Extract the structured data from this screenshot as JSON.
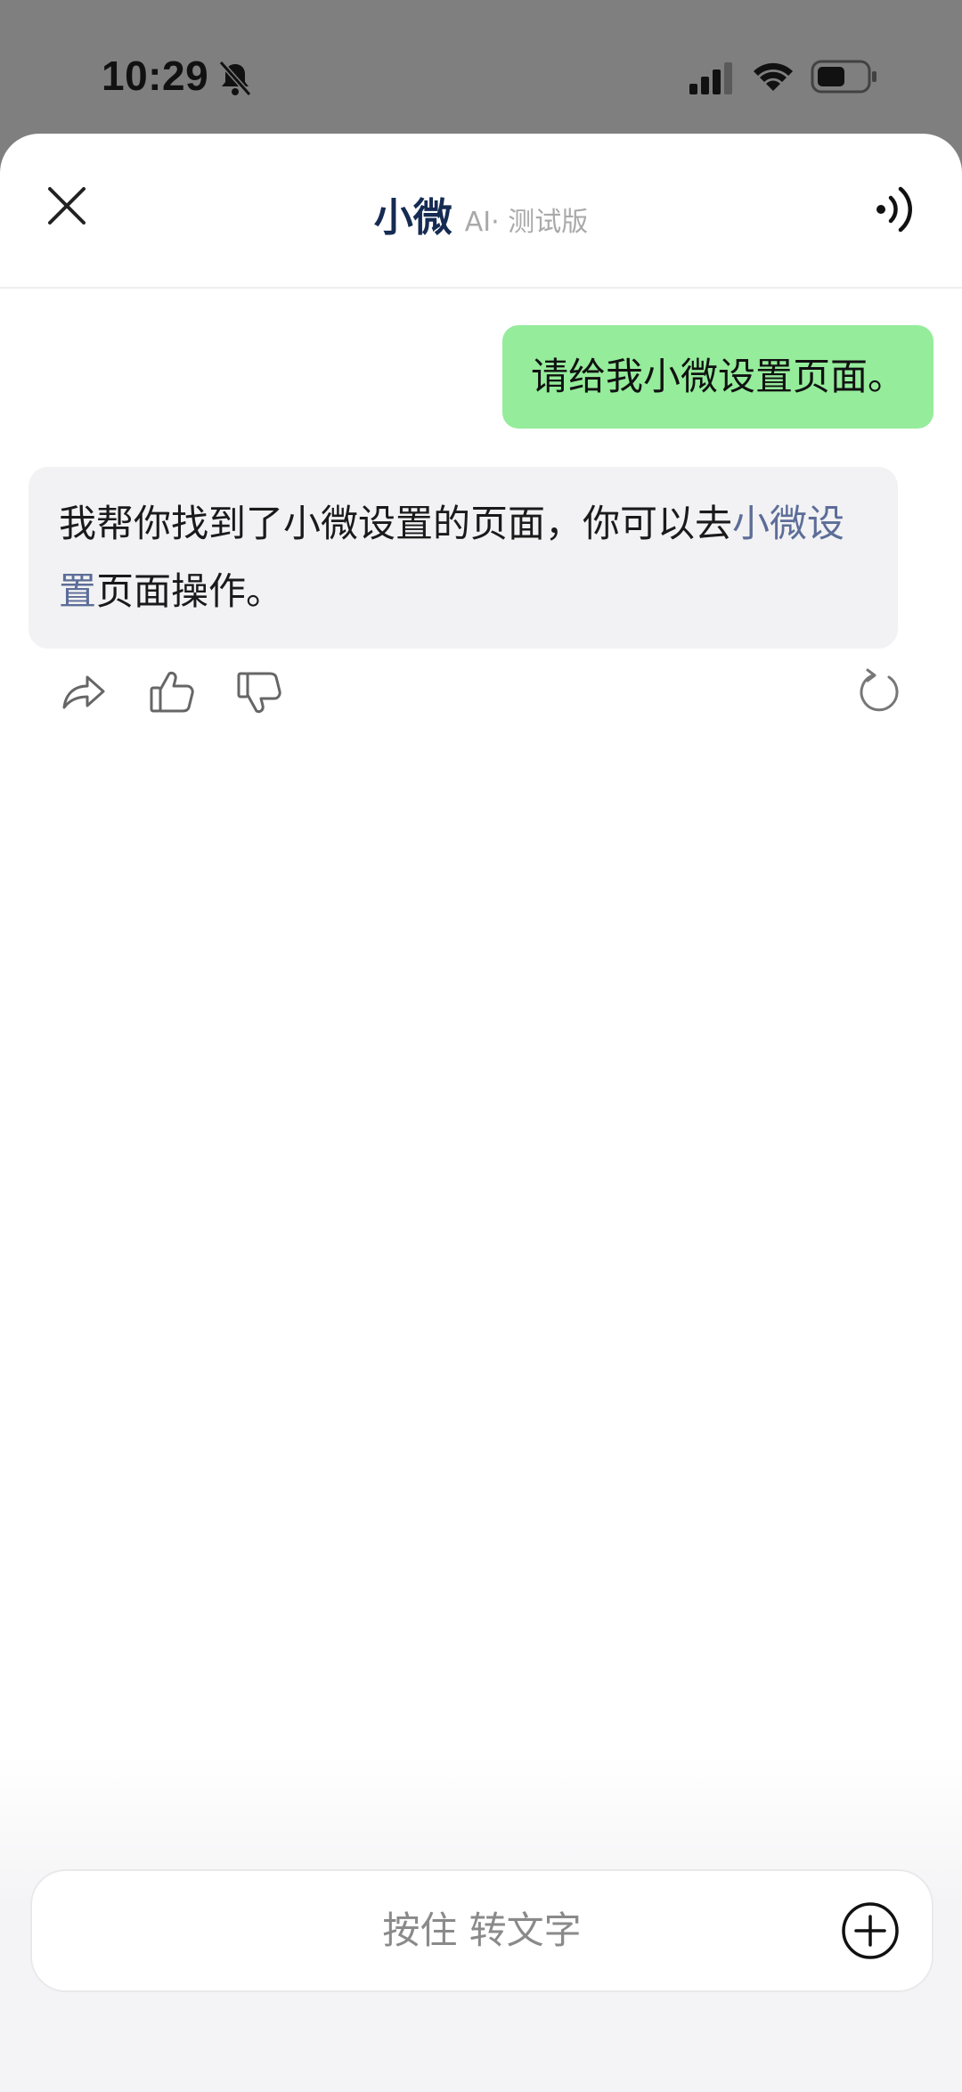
{
  "status_bar": {
    "time": "10:29",
    "icons": [
      "bell-muted-icon",
      "cellular-signal-icon",
      "wifi-icon",
      "battery-icon"
    ]
  },
  "header": {
    "title": "小微",
    "subtitle": "AI· 测试版",
    "close_icon": "close-icon",
    "speaker_icon": "speaker-icon"
  },
  "messages": {
    "user": "请给我小微设置页面。",
    "bot": {
      "text_before": "我帮你找到了小微设置的页面，你可以去",
      "link": "小微设置",
      "text_after": "页面操作。"
    }
  },
  "message_actions": [
    "share-icon",
    "thumbs-up-icon",
    "thumbs-down-icon",
    "refresh-icon"
  ],
  "input": {
    "placeholder": "按住 转文字",
    "plus_icon": "plus-circle-icon"
  },
  "colors": {
    "user_bubble": "#95ec9b",
    "bot_bubble": "#f2f2f4",
    "link": "#5d6d98",
    "title": "#152b52"
  }
}
